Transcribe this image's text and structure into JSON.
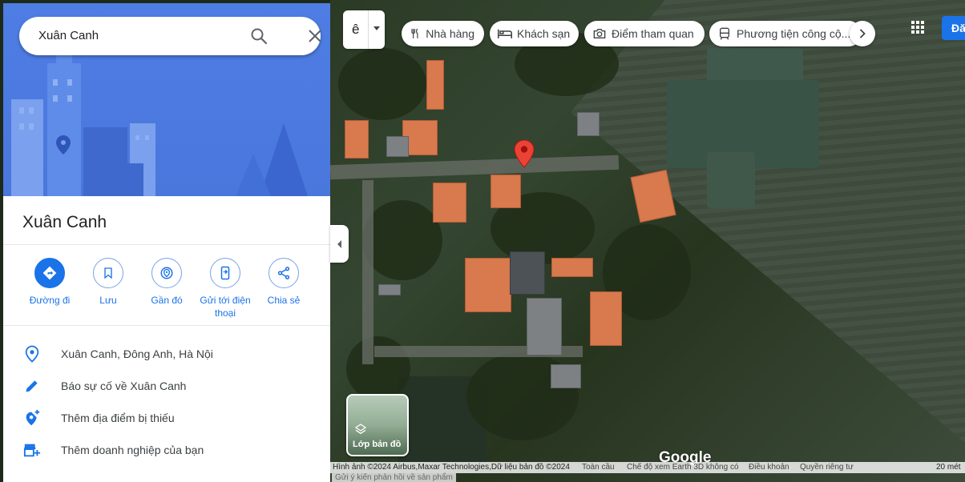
{
  "search": {
    "query": "Xuân Canh"
  },
  "place": {
    "title": "Xuân Canh"
  },
  "actions": [
    {
      "label": "Đường đi"
    },
    {
      "label": "Lưu"
    },
    {
      "label": "Gần đó"
    },
    {
      "label": "Gửi tới điện thoại"
    },
    {
      "label": "Chia sẻ"
    }
  ],
  "info": [
    {
      "text": "Xuân Canh, Đông Anh, Hà Nội"
    },
    {
      "text": "Báo sự cố về Xuân Canh"
    },
    {
      "text": "Thêm địa điểm bị thiếu"
    },
    {
      "text": "Thêm doanh nghiệp của bạn"
    }
  ],
  "ime": {
    "letter": "ê"
  },
  "chips": [
    {
      "label": "Nhà hàng"
    },
    {
      "label": "Khách sạn"
    },
    {
      "label": "Điểm tham quan"
    },
    {
      "label": "Phương tiện công cộ..."
    }
  ],
  "signin": {
    "label": "Đă"
  },
  "layers": {
    "label": "Lớp bản đồ"
  },
  "map": {
    "logo": "Google"
  },
  "footer": {
    "imagery": "Hình ảnh ©2024 Airbus,Maxar Technologies,Dữ liệu bản đồ ©2024",
    "global": "Toàn cầu",
    "earth3d": "Chế độ xem Earth 3D không có",
    "terms": "Điều khoản",
    "privacy": "Quyền riêng tư",
    "scale": "20 mét",
    "feedback": "Gửi ý kiến phản hồi về sản phẩm"
  },
  "colors": {
    "accent": "#1a73e8",
    "pin": "#ea4335"
  }
}
